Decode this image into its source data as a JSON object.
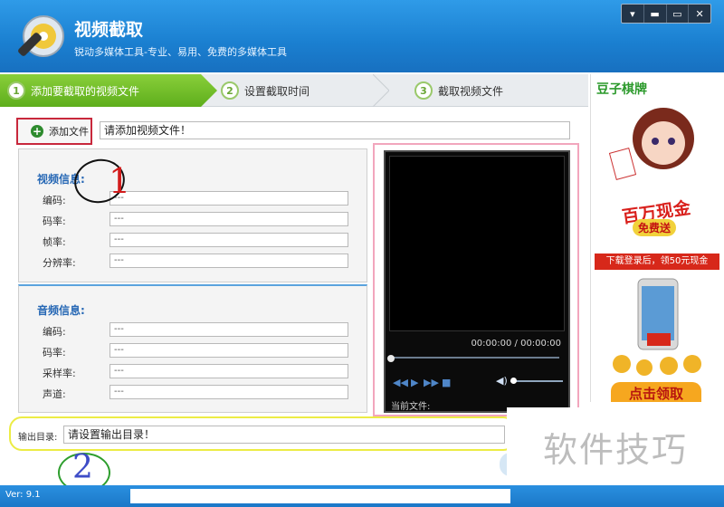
{
  "app": {
    "title": "视频截取",
    "subtitle": "锐动多媒体工具-专业、易用、免费的多媒体工具"
  },
  "window_controls": [
    "▾",
    "▬",
    "▭",
    "✕"
  ],
  "steps": [
    {
      "num": "1",
      "label": "添加要截取的视频文件",
      "active": true
    },
    {
      "num": "2",
      "label": "设置截取时间",
      "active": false
    },
    {
      "num": "3",
      "label": "截取视频文件",
      "active": false
    }
  ],
  "add_file": {
    "label": "添加文件",
    "placeholder": "请添加视频文件！"
  },
  "video_info": {
    "title": "视频信息:",
    "rows": [
      {
        "label": "编码:",
        "value": "---"
      },
      {
        "label": "码率:",
        "value": "---"
      },
      {
        "label": "帧率:",
        "value": "---"
      },
      {
        "label": "分辨率:",
        "value": "---"
      }
    ]
  },
  "audio_info": {
    "title": "音频信息:",
    "rows": [
      {
        "label": "编码:",
        "value": "---"
      },
      {
        "label": "码率:",
        "value": "---"
      },
      {
        "label": "采样率:",
        "value": "---"
      },
      {
        "label": "声道:",
        "value": "---"
      }
    ]
  },
  "player": {
    "time": "00:00:00 / 00:00:00",
    "current_file_label": "当前文件:"
  },
  "output": {
    "label": "输出目录:",
    "placeholder": "请设置输出目录！"
  },
  "ad": {
    "brand": "豆子棋牌",
    "slogan": "百万现金",
    "free": "免费送",
    "banner": "下载登录后，领50元现金",
    "cta": "点击领取"
  },
  "annotations": {
    "one": "1",
    "two": "2"
  },
  "footer": {
    "version": "Ver: 9.1"
  },
  "watermark": "软件技巧",
  "colors": {
    "titlebar": "#1a7fd0",
    "step_active": "#6fbf2a",
    "annotation_red": "#c8283c",
    "highlight_yellow": "#ecec44"
  }
}
